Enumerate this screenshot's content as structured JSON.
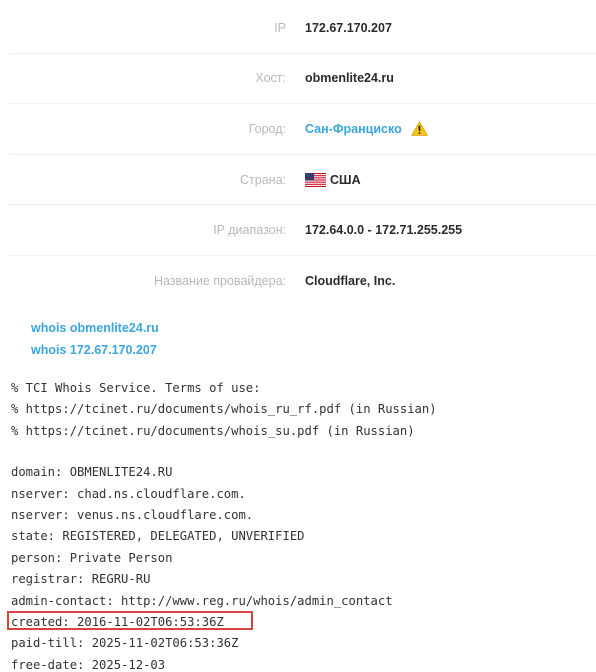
{
  "info": {
    "ip_label": "IP",
    "ip_value": "172.67.170.207",
    "host_label": "Хост:",
    "host_value": "obmenlite24.ru",
    "city_label": "Город:",
    "city_value": "Сан-Франциско",
    "country_label": "Страна:",
    "country_value": "США",
    "range_label": "IP диапазон:",
    "range_value": "172.64.0.0 - 172.71.255.255",
    "provider_label": "Название провайдера:",
    "provider_value": "Cloudflare, Inc."
  },
  "links": {
    "whois_domain": "whois obmenlite24.ru",
    "whois_ip": "whois 172.67.170.207"
  },
  "whois": {
    "header": [
      "% TCI Whois Service. Terms of use:",
      "% https://tcinet.ru/documents/whois_ru_rf.pdf (in Russian)",
      "% https://tcinet.ru/documents/whois_su.pdf (in Russian)"
    ],
    "records": [
      "domain: OBMENLITE24.RU",
      "nserver: chad.ns.cloudflare.com.",
      "nserver: venus.ns.cloudflare.com.",
      "state: REGISTERED, DELEGATED, UNVERIFIED",
      "person: Private Person",
      "registrar: REGRU-RU",
      "admin-contact: http://www.reg.ru/whois/admin_contact",
      "created: 2016-11-02T06:53:36Z",
      "paid-till: 2025-11-02T06:53:36Z",
      "free-date: 2025-12-03"
    ]
  },
  "colors": {
    "link": "#3ba6dd",
    "label": "#b8b8b8",
    "highlight_border": "#d9453e",
    "warning": "#f5c518"
  },
  "icons": {
    "warning": "warning-icon",
    "flag": "us-flag-icon"
  }
}
